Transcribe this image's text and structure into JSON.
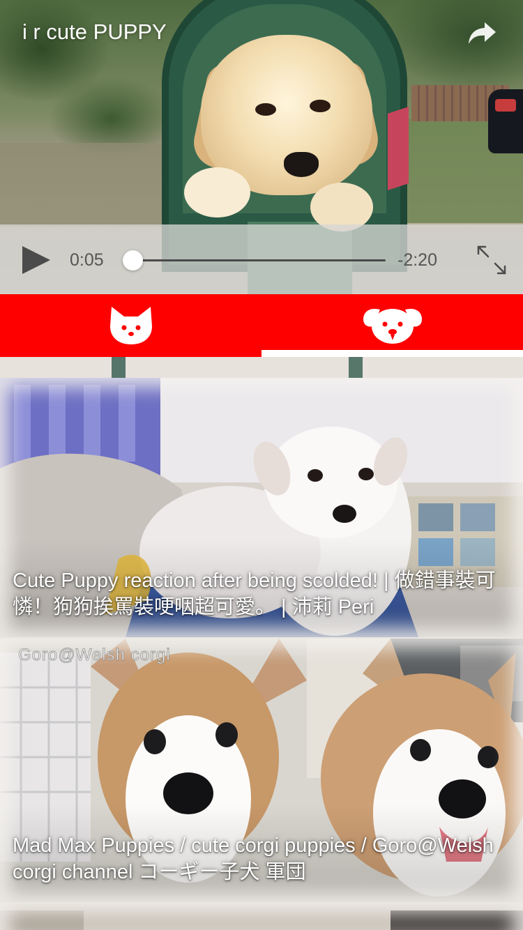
{
  "player": {
    "title": "i r cute PUPPY",
    "elapsed": "0:05",
    "remaining": "-2:20",
    "progress": 0.036,
    "share_icon": "share-icon",
    "play_icon": "play-icon",
    "fullscreen_icon": "expand-icon"
  },
  "tabs": [
    {
      "icon": "cat-face-icon",
      "selected": false
    },
    {
      "icon": "dog-face-icon",
      "selected": true
    }
  ],
  "feed": {
    "items": [
      {
        "title": "Cute Puppy reaction after being scolded! | 做錯事裝可憐！狗狗挨罵裝哽咽超可愛。 | 沛莉 Peri"
      },
      {
        "title": "Mad Max Puppies / cute corgi puppies / Goro@Welsh corgi channel コーギー子犬 軍団",
        "watermark": "Goro@Welsh corgi"
      }
    ]
  },
  "colors": {
    "tab_bar": "#ff0000",
    "indicator": "#ffffff",
    "controls_bg": "#d6d6d4",
    "control_text": "#555555"
  }
}
